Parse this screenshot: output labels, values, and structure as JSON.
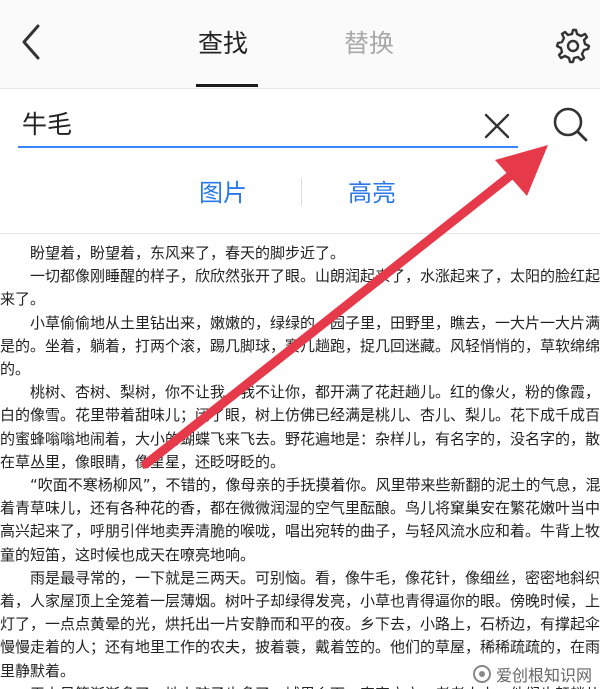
{
  "header": {
    "tab_find": "查找",
    "tab_replace": "替换",
    "icons": {
      "back": "chevron-left-icon",
      "settings": "gear-icon"
    }
  },
  "search": {
    "value": "牛毛",
    "icons": {
      "clear": "close-icon",
      "search": "search-icon"
    },
    "accent": "#3a86ff"
  },
  "options": {
    "image": "图片",
    "highlight": "高亮",
    "color": "#2a79ea"
  },
  "document": {
    "lines": [
      "　　盼望着，盼望着，东风来了，春天的脚步近了。",
      "　　一切都像刚睡醒的样子，欣欣然张开了眼。山朗润起来了，水涨起来了，太阳的脸红起",
      "来了。",
      "　　小草偷偷地从土里钻出来，嫩嫩的，绿绿的。园子里，田野里，瞧去，一大片一大片满",
      "是的。坐着，躺着，打两个滚，踢几脚球，赛几趟跑，捉几回迷藏。风轻悄悄的，草软绵绵",
      "的。",
      "　　桃树、杏树、梨树，你不让我，我不让你，都开满了花赶趟儿。红的像火，粉的像霞，",
      "白的像雪。花里带着甜味儿；闭了眼，树上仿佛已经满是桃儿、杏儿、梨儿。花下成千成百",
      "的蜜蜂嗡嗡地闹着，大小的蝴蝶飞来飞去。野花遍地是：杂样儿，有名字的，没名字的，散",
      "在草丛里，像眼睛，像星星，还眨呀眨的。",
      "　　“吹面不寒杨柳风”，不错的，像母亲的手抚摸着你。风里带来些新翻的泥土的气息，混",
      "着青草味儿，还有各种花的香，都在微微润湿的空气里酝酿。鸟儿将窠巢安在繁花嫩叶当中，",
      "高兴起来了，呼朋引伴地卖弄清脆的喉咙，唱出宛转的曲子，与轻风流水应和着。牛背上牧",
      "童的短笛，这时候也成天在嘹亮地响。",
      "　　雨是最寻常的，一下就是三两天。可别恼。看，像牛毛，像花针，像细丝，密密地斜织",
      "着，人家屋顶上全笼着一层薄烟。树叶子却绿得发亮，小草也青得逼你的眼。傍晚时候，上",
      "灯了，一点点黄晕的光，烘托出一片安静而和平的夜。乡下去，小路上，石桥边，有撑起伞",
      "慢慢走着的人；还有地里工作的农夫，披着蓑，戴着笠的。他们的草屋，稀稀疏疏的，在雨",
      "里静默着。",
      "　　天上风筝渐渐多了，地上孩子也多了。城里乡下，家家户户，老老小小，他们也赶趟儿"
    ]
  },
  "watermark": {
    "text": "爱创根知识网"
  },
  "annotation": {
    "arrow_color": "#e6394a"
  }
}
